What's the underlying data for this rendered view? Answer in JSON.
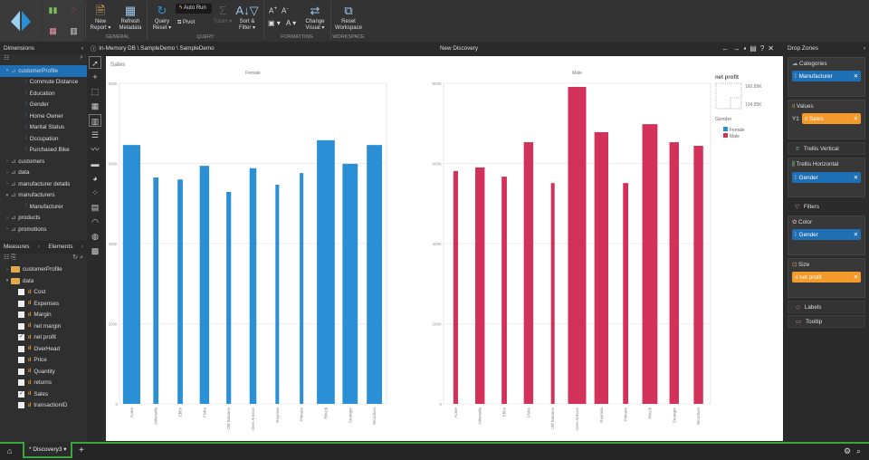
{
  "ribbon": {
    "buttons": {
      "new_report": "New Report ▾",
      "refresh_metadata": "Refresh Metadata",
      "query_reset": "Query Reset ▾",
      "auto_run": "Auto Run",
      "pivot": "Pivot",
      "totals": "Totals ▾",
      "sort_filter": "Sort & Filter ▾",
      "change_visual": "Change Visual ▾",
      "reset_workspace": "Reset Workspace"
    },
    "groups": {
      "general": "GENERAL",
      "query": "QUERY",
      "formatting": "FORMATTING",
      "workspace": "WORKSPACE"
    }
  },
  "left": {
    "dimensions_title": "Dimensions",
    "dimensions": [
      {
        "label": "customerProfile",
        "level": 0,
        "selected": true,
        "open": true
      },
      {
        "label": "Commute Distance",
        "level": 1
      },
      {
        "label": "Education",
        "level": 1
      },
      {
        "label": "Gender",
        "level": 1
      },
      {
        "label": "Home Owner",
        "level": 1
      },
      {
        "label": "Marital Status",
        "level": 1
      },
      {
        "label": "Occupation",
        "level": 1
      },
      {
        "label": "Purchased Bike",
        "level": 1
      },
      {
        "label": "customers",
        "level": 0
      },
      {
        "label": "data",
        "level": 0
      },
      {
        "label": "manufacturer details",
        "level": 0
      },
      {
        "label": "manufacturers",
        "level": 0,
        "open": true
      },
      {
        "label": "Manufacturer",
        "level": 1
      },
      {
        "label": "products",
        "level": 0
      },
      {
        "label": "promotions",
        "level": 0
      }
    ],
    "measures_tab": "Measures",
    "elements_tab": "Elements",
    "folders": [
      "customerProfile",
      "data"
    ],
    "measures": [
      {
        "label": "Cost",
        "checked": false
      },
      {
        "label": "Expenses",
        "checked": false
      },
      {
        "label": "Margin",
        "checked": false
      },
      {
        "label": "net margin",
        "checked": false
      },
      {
        "label": "net profit",
        "checked": true
      },
      {
        "label": "OverHead",
        "checked": false
      },
      {
        "label": "Price",
        "checked": false
      },
      {
        "label": "Quantity",
        "checked": false
      },
      {
        "label": "returns",
        "checked": false
      },
      {
        "label": "Sales",
        "checked": true
      },
      {
        "label": "transactionID",
        "checked": false
      }
    ]
  },
  "path": "In-Memory DB \\ SampleDemo \\ SampleDemo",
  "title": "New Discovery",
  "right": {
    "title": "Drop Zones",
    "categories": "Categories",
    "categories_pill": "Manufacturer",
    "values": "Values",
    "values_prefix": "Y1",
    "values_pill": "Sales",
    "trellis_v": "Trellis Vertical",
    "trellis_h": "Trellis Horizontal",
    "trellis_h_pill": "Gender",
    "filters": "Filters",
    "color": "Color",
    "color_pill": "Gender",
    "size": "Size",
    "size_pill": "net profit",
    "labels": "Labels",
    "tooltip": "Tooltip"
  },
  "bottom": {
    "tab": "* Discovery3"
  },
  "chart_data": {
    "type": "bar",
    "title": "Sales",
    "categories": [
      "Acme",
      "Adrenalin",
      "Ebbs",
      "Fluke",
      "Old Balance",
      "Over Armour",
      "Rayman",
      "Primate",
      "Rbuck",
      "Stranger",
      "Woodson"
    ],
    "yticks": [
      "0",
      "200K",
      "400K",
      "600K",
      "800K"
    ],
    "ylim": [
      0,
      800000
    ],
    "colors": {
      "Female": "#2b8fd6",
      "Male": "#d2325a"
    },
    "series": [
      {
        "name": "Female",
        "values": [
          646000,
          565000,
          560000,
          594000,
          529000,
          588000,
          547000,
          576000,
          658000,
          599000,
          646000
        ],
        "net_profit": [
          158000,
          112000,
          112000,
          128000,
          110000,
          118000,
          106000,
          106000,
          160000,
          150000,
          150000
        ]
      },
      {
        "name": "Male",
        "values": [
          581000,
          590000,
          567000,
          653000,
          551000,
          791000,
          678000,
          551000,
          698000,
          653000,
          644000
        ],
        "net_profit": [
          110000,
          128000,
          112000,
          128000,
          106000,
          161000,
          145000,
          112000,
          150000,
          128000,
          128000
        ]
      }
    ],
    "legend": {
      "size_title": "net profit",
      "size_max": "160.89K",
      "size_min": "104.85K",
      "color_title": "Gender",
      "entries": [
        "Female",
        "Male"
      ]
    }
  }
}
